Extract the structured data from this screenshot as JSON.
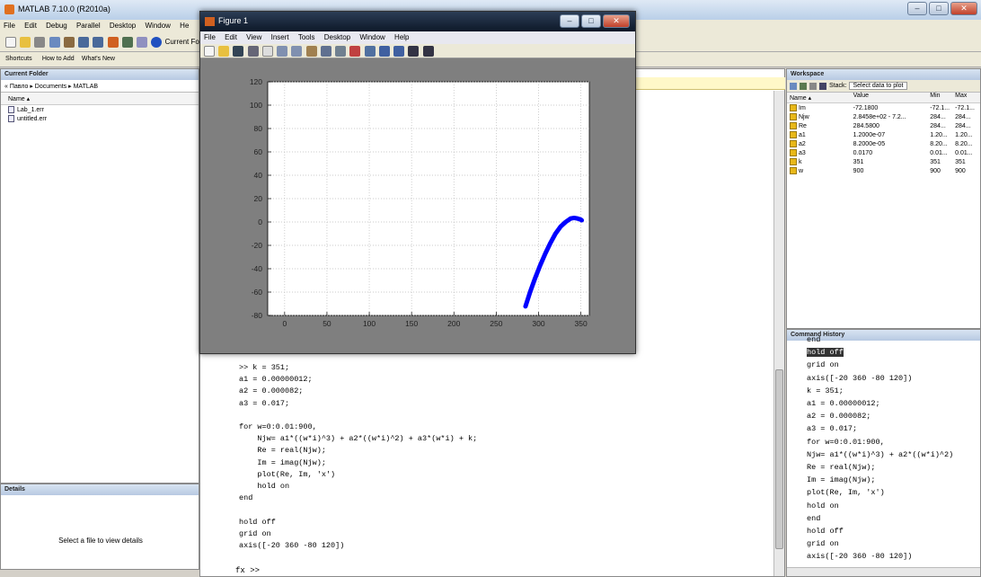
{
  "app": {
    "title": "MATLAB 7.10.0 (R2010a)"
  },
  "menu": [
    "File",
    "Edit",
    "Debug",
    "Parallel",
    "Desktop",
    "Window",
    "He"
  ],
  "toolbar": {
    "current_folder_label": "Current Fold"
  },
  "shortcuts": {
    "label": "Shortcuts",
    "how_to_add": "How to Add",
    "whats_new": "What's New"
  },
  "current_folder": {
    "title": "Current Folder",
    "path": "« Павло ▸ Documents ▸ MATLAB",
    "column": "Name ▴",
    "files": [
      "Lab_1.err",
      "untitled.err"
    ]
  },
  "details": {
    "title": "Details",
    "message": "Select a file to view details"
  },
  "figure": {
    "title": "Figure 1",
    "menu": [
      "File",
      "Edit",
      "View",
      "Insert",
      "Tools",
      "Desktop",
      "Window",
      "Help"
    ]
  },
  "chart_data": {
    "type": "line",
    "title": "",
    "xlabel": "",
    "ylabel": "",
    "xlim": [
      -20,
      360
    ],
    "ylim": [
      -80,
      120
    ],
    "xticks": [
      0,
      50,
      100,
      150,
      200,
      250,
      300,
      350
    ],
    "yticks": [
      -80,
      -60,
      -40,
      -20,
      0,
      20,
      40,
      60,
      80,
      100,
      120
    ],
    "grid": true,
    "series": [
      {
        "color": "#0000ff",
        "marker": "x",
        "x": [
          284.58,
          290,
          296,
          302,
          308,
          314,
          320,
          326,
          332,
          338,
          342,
          346,
          348,
          350,
          351
        ],
        "y": [
          -72.18,
          -60,
          -48,
          -37,
          -27,
          -18,
          -10,
          -4,
          0,
          3,
          3.5,
          3,
          2.5,
          2,
          1.5
        ]
      }
    ]
  },
  "command": {
    "lines": [
      ">> k = 351;",
      "a1 = 0.00000012;",
      "a2 = 0.000082;",
      "a3 = 0.017;",
      "",
      "for w=0:0.01:900,",
      "    Njw= a1*((w*i)^3) + a2*((w*i)^2) + a3*(w*i) + k;",
      "    Re = real(Njw);",
      "    Im = imag(Njw);",
      "    plot(Re, Im, 'x')",
      "    hold on",
      "end",
      "",
      "hold off",
      "grid on",
      "axis([-20 360 -80 120])"
    ],
    "prompt": "fx >>"
  },
  "workspace": {
    "title": "Workspace",
    "stack_label": "Stack:",
    "select_plot": "Select data to plot",
    "columns": [
      "Name ▴",
      "Value",
      "Min",
      "Max"
    ],
    "rows": [
      {
        "name": "Im",
        "value": "-72.1800",
        "min": "-72.1...",
        "max": "-72.1..."
      },
      {
        "name": "Njw",
        "value": "2.8458e+02 - 7.2...",
        "min": "284...",
        "max": "284..."
      },
      {
        "name": "Re",
        "value": "284.5800",
        "min": "284...",
        "max": "284..."
      },
      {
        "name": "a1",
        "value": "1.2000e-07",
        "min": "1.20...",
        "max": "1.20..."
      },
      {
        "name": "a2",
        "value": "8.2000e-05",
        "min": "8.20...",
        "max": "8.20..."
      },
      {
        "name": "a3",
        "value": "0.0170",
        "min": "0.01...",
        "max": "0.01..."
      },
      {
        "name": "k",
        "value": "351",
        "min": "351",
        "max": "351"
      },
      {
        "name": "w",
        "value": "900",
        "min": "900",
        "max": "900"
      }
    ]
  },
  "history": {
    "title": "Command History",
    "lines": [
      "end",
      "hold off",
      "grid on",
      "axis([-20 360 -80 120])",
      "k = 351;",
      "a1 = 0.00000012;",
      "a2 = 0.000082;",
      "a3 = 0.017;",
      "for w=0:0.01:900,",
      "Njw= a1*((w*i)^3) + a2*((w*i)^2)",
      "Re = real(Njw);",
      "Im = imag(Njw);",
      "plot(Re, Im, 'x')",
      "hold on",
      "end",
      "hold off",
      "grid on",
      "axis([-20 360 -80 120])"
    ]
  }
}
